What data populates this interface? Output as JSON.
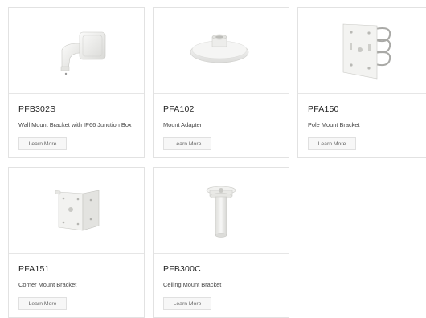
{
  "products": [
    {
      "model": "PFB302S",
      "description": "Wall Mount Bracket with IP66 Junction Box",
      "button_label": "Learn More",
      "image_icon": "wall-mount-bracket-icon"
    },
    {
      "model": "PFA102",
      "description": "Mount Adapter",
      "button_label": "Learn More",
      "image_icon": "mount-adapter-icon"
    },
    {
      "model": "PFA150",
      "description": "Pole Mount Bracket",
      "button_label": "Learn More",
      "image_icon": "pole-mount-bracket-icon"
    },
    {
      "model": "PFA151",
      "description": "Corner Mount Bracket",
      "button_label": "Learn More",
      "image_icon": "corner-mount-bracket-icon"
    },
    {
      "model": "PFB300C",
      "description": "Ceiling Mount Bracket",
      "button_label": "Learn More",
      "image_icon": "ceiling-mount-bracket-icon"
    }
  ],
  "colors": {
    "card_border": "#e2e2e2",
    "button_bg": "#f7f7f7",
    "product_white": "#f2f2f0"
  }
}
